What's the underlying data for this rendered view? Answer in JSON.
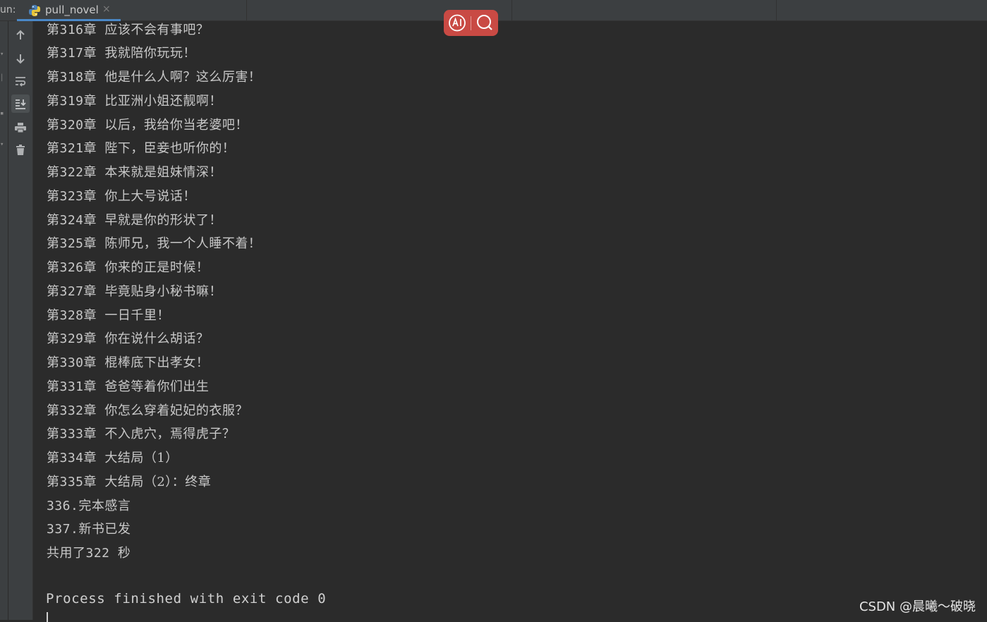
{
  "tabbar": {
    "run_label": "un:",
    "tab_title": "pull_novel",
    "tab_close": "×",
    "tab_icon": "python-icon"
  },
  "toolbar": {
    "buttons": [
      {
        "icon": "arrow-up-icon",
        "label": "Up"
      },
      {
        "icon": "arrow-down-icon",
        "label": "Down"
      },
      {
        "icon": "soft-wrap-icon",
        "label": "Soft-wrap"
      },
      {
        "icon": "scroll-to-end-icon",
        "label": "Scroll to end",
        "active": true
      },
      {
        "icon": "print-icon",
        "label": "Print"
      },
      {
        "icon": "trash-icon",
        "label": "Clear all"
      }
    ]
  },
  "console": {
    "lines": [
      {
        "prefix": "第316章",
        "title": "应该不会有事吧？"
      },
      {
        "prefix": "第317章",
        "title": "我就陪你玩玩！"
      },
      {
        "prefix": "第318章",
        "title": "他是什么人啊？这么厉害！"
      },
      {
        "prefix": "第319章",
        "title": "比亚洲小姐还靓啊！"
      },
      {
        "prefix": "第320章",
        "title": "以后，我给你当老婆吧！"
      },
      {
        "prefix": "第321章",
        "title": "陛下，臣妾也听你的！"
      },
      {
        "prefix": "第322章",
        "title": "本来就是姐妹情深！"
      },
      {
        "prefix": "第323章",
        "title": "你上大号说话！"
      },
      {
        "prefix": "第324章",
        "title": "早就是你的形状了！"
      },
      {
        "prefix": "第325章",
        "title": "陈师兄，我一个人睡不着！"
      },
      {
        "prefix": "第326章",
        "title": "你来的正是时候！"
      },
      {
        "prefix": "第327章",
        "title": "毕竟贴身小秘书嘛！"
      },
      {
        "prefix": "第328章",
        "title": "一日千里！"
      },
      {
        "prefix": "第329章",
        "title": "你在说什么胡话？"
      },
      {
        "prefix": "第330章",
        "title": "棍棒底下出孝女！"
      },
      {
        "prefix": "第331章",
        "title": "爸爸等着你们出生"
      },
      {
        "prefix": "第332章",
        "title": "你怎么穿着妃妃的衣服？"
      },
      {
        "prefix": "第333章",
        "title": "不入虎穴，焉得虎子？"
      },
      {
        "prefix": "第334章",
        "title": "大结局（1）"
      },
      {
        "prefix": "第335章",
        "title": "大结局（2）：终章"
      },
      {
        "prefix": "336.",
        "title": "完本感言"
      },
      {
        "prefix": "337.",
        "title": "新书已发"
      },
      {
        "prefix": "共用了322",
        "title": "秒"
      }
    ],
    "process_text": "Process finished with exit code 0"
  },
  "float_widget": {
    "ai_icon": "ai-icon",
    "search_icon": "search-icon"
  },
  "watermark": "CSDN @晨曦～破晓",
  "colors": {
    "console_bg": "#2b2b2b",
    "panel_bg": "#3c3f41",
    "text": "#c8c8c8",
    "tab_underline": "#4a88c7",
    "widget_red": "#c94a44"
  }
}
